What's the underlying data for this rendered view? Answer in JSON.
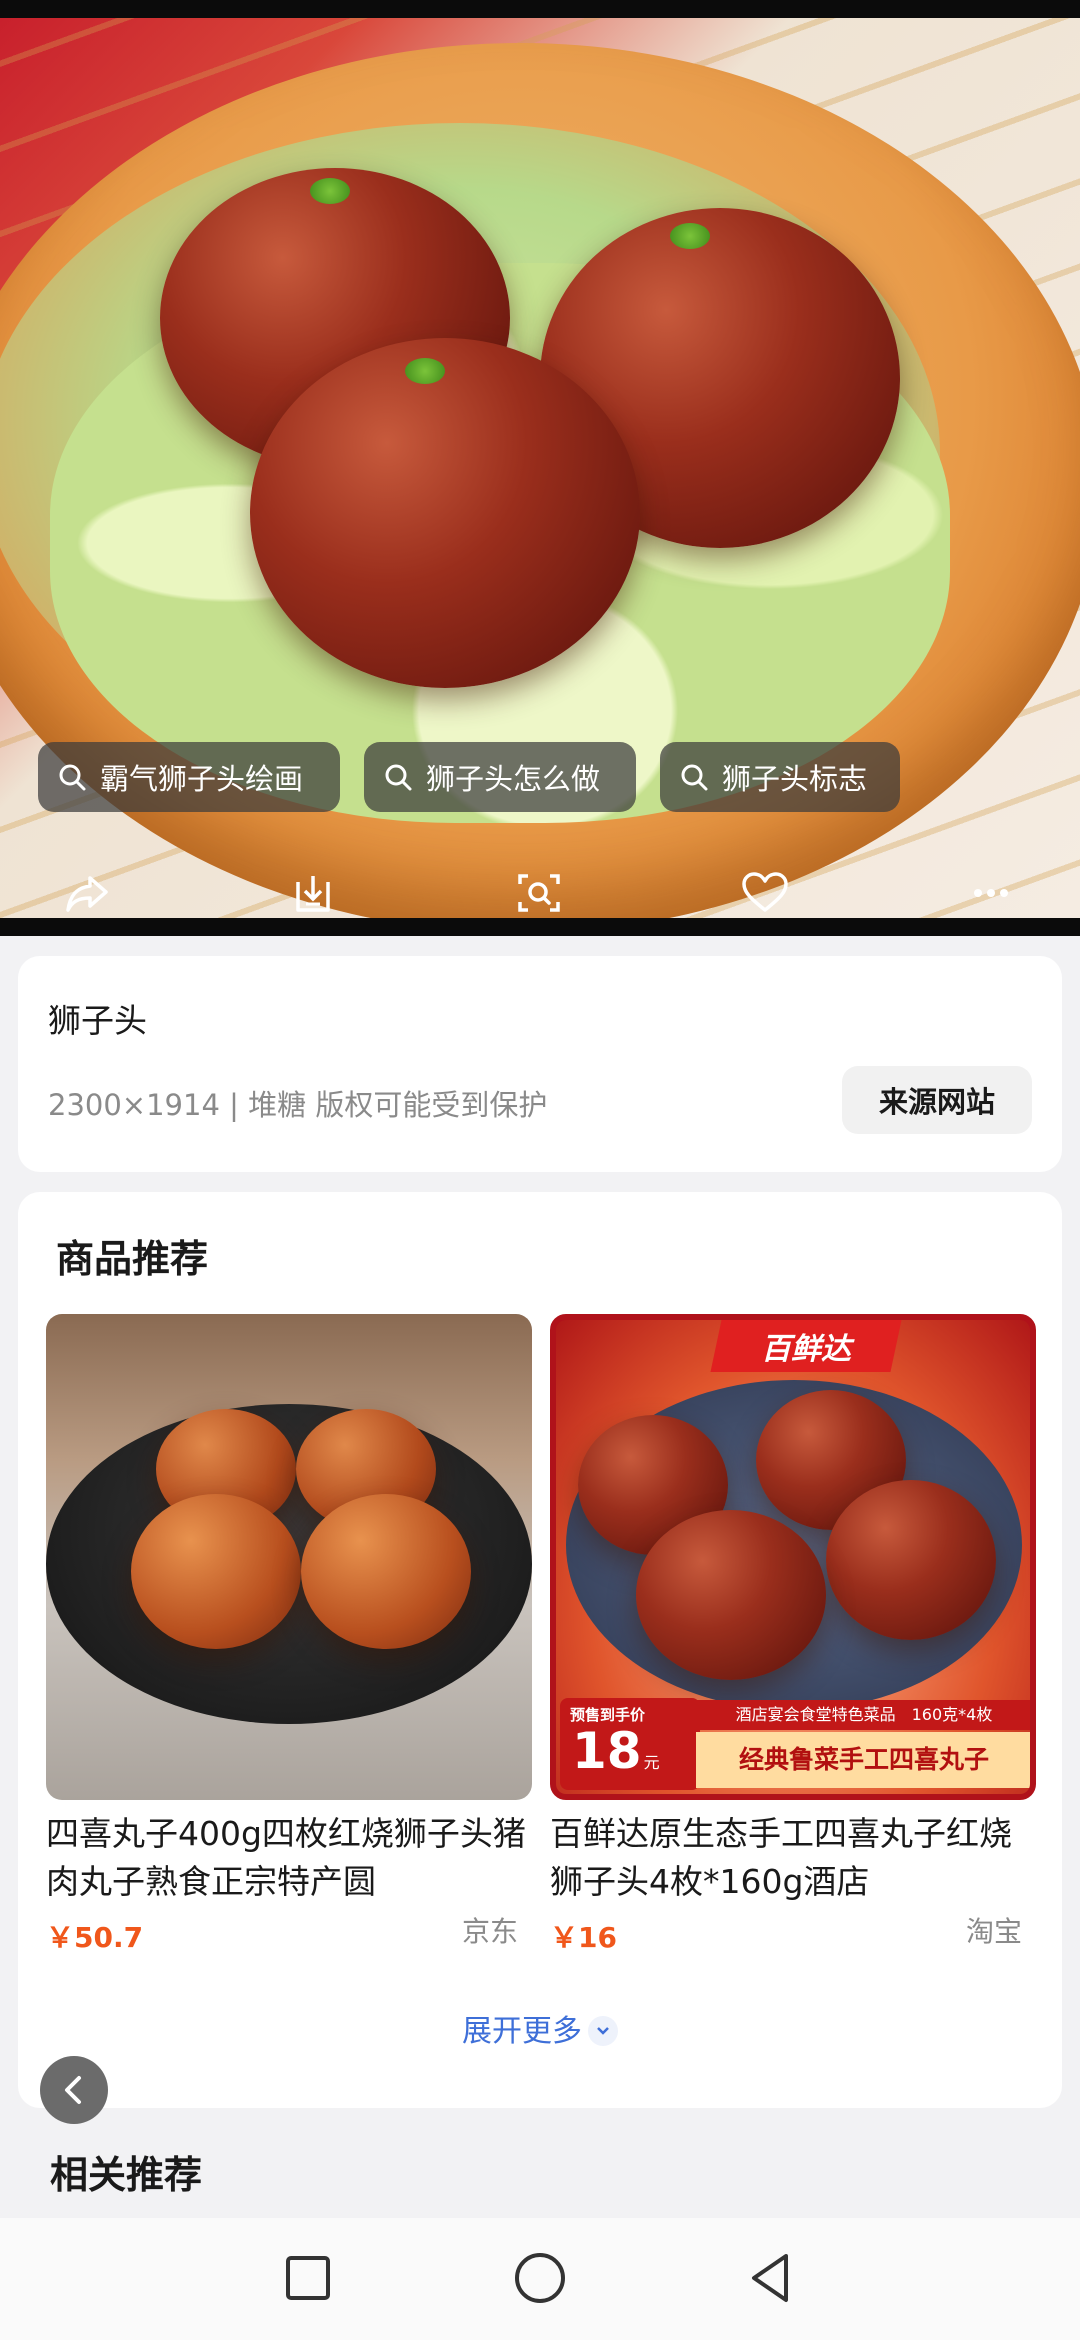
{
  "hero": {
    "chips": [
      {
        "label": "霸气狮子头绘画"
      },
      {
        "label": "狮子头怎么做"
      },
      {
        "label": "狮子头标志"
      }
    ],
    "actions": [
      "share-icon",
      "download-icon",
      "visual-search-icon",
      "heart-icon",
      "more-icon"
    ]
  },
  "info": {
    "title": "狮子头",
    "meta": "2300×1914 | 堆糖 版权可能受到保护",
    "source_button": "来源网站"
  },
  "products": {
    "section_title": "商品推荐",
    "items": [
      {
        "title": "四喜丸子400g四枚红烧狮子头猪肉丸子熟食正宗特产圆",
        "price": "￥50.7",
        "store": "京东"
      },
      {
        "title": "百鲜达原生态手工四喜丸子红烧狮子头4枚*160g酒店",
        "price": "￥16",
        "store": "淘宝",
        "image_brand": "百鲜达",
        "image_price_tag_label": "预售到手价",
        "image_price_tag_value": "18",
        "image_price_tag_unit": "元",
        "image_banner_small": "酒店宴会食堂特色菜品　160克*4枚",
        "image_banner_large": "经典鲁菜手工四喜丸子"
      }
    ],
    "expand_label": "展开更多"
  },
  "related": {
    "title": "相关推荐"
  },
  "nav": {
    "buttons": [
      "recent-apps-icon",
      "home-icon",
      "back-icon"
    ]
  }
}
